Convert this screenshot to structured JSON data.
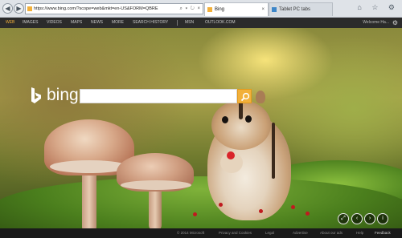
{
  "browser": {
    "address": "https://www.bing.com/?scope=web&mkt=en-US&FORM=QBRE",
    "address_tools": "⌕ ▾ ↻ ×",
    "tabs": [
      {
        "label": "Bing",
        "close": "×"
      },
      {
        "label": "Tablet PC tabs"
      }
    ],
    "window_icons": "⌂ ☆ ⚙"
  },
  "topnav": {
    "items": [
      "WEB",
      "IMAGES",
      "VIDEOS",
      "MAPS",
      "NEWS",
      "MORE",
      "SEARCH HISTORY",
      "MSN",
      "OUTLOOK.COM"
    ],
    "active": "WEB",
    "right_text": "Welcome Ha..."
  },
  "logo": {
    "text": "bing"
  },
  "search": {
    "value": "",
    "placeholder": ""
  },
  "controls": {
    "expand": "⤢",
    "prev": "‹",
    "next": "›",
    "info": "i"
  },
  "footer": {
    "items": [
      "© 2014 Microsoft",
      "Privacy and Cookies",
      "Legal",
      "Advertise",
      "About our ads",
      "Help",
      "Feedback"
    ]
  },
  "colors": {
    "accent": "#f2b03a",
    "nav_bg": "#2b2b2b",
    "footer_bg": "#1a1a1a"
  }
}
